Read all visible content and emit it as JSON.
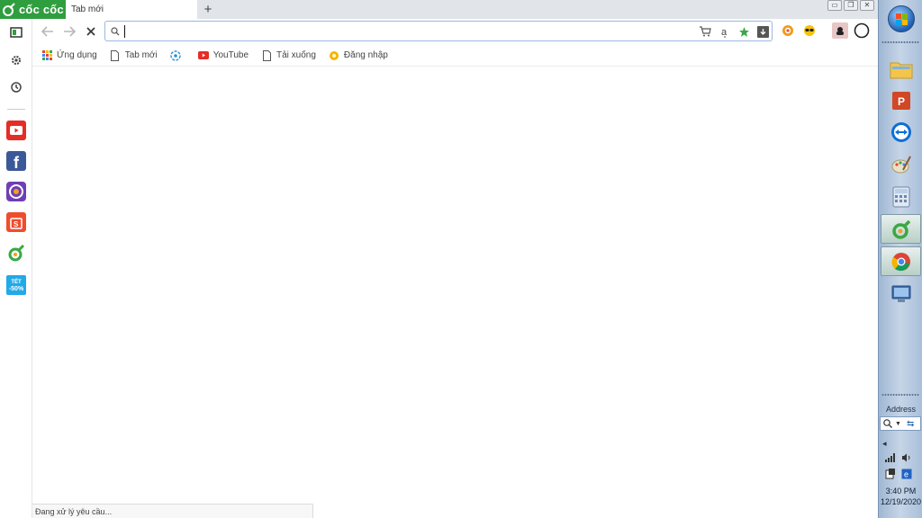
{
  "browser": {
    "logo_text": "cốc cốc",
    "tab_title": "Tab mới",
    "new_tab_label": "+",
    "window_buttons": [
      "minimize",
      "restore",
      "close"
    ],
    "omnibox": {
      "value": "",
      "placeholder": ""
    },
    "bookmarks": [
      {
        "label": "Ứng dụng",
        "icon": "apps-grid-icon"
      },
      {
        "label": "Tab mới",
        "icon": "page-icon"
      },
      {
        "label": "",
        "icon": "coccoc-compass-icon"
      },
      {
        "label": "YouTube",
        "icon": "youtube-icon"
      },
      {
        "label": "Tải xuống",
        "icon": "page-icon"
      },
      {
        "label": "Đăng nhập",
        "icon": "login-icon"
      }
    ],
    "status_text": "Đang xử lý yêu cầu...",
    "sidebar_promo_badge_top": "TẾT",
    "sidebar_promo_badge_bottom": "-50%"
  },
  "taskbar": {
    "address_label": "Address",
    "clock_time": "3:40 PM",
    "clock_date": "12/19/2020"
  },
  "colors": {
    "coccoc_green": "#2f9e3f",
    "omnibox_border": "#9cb7e0",
    "taskbar_blue": "#b4c8e0"
  }
}
